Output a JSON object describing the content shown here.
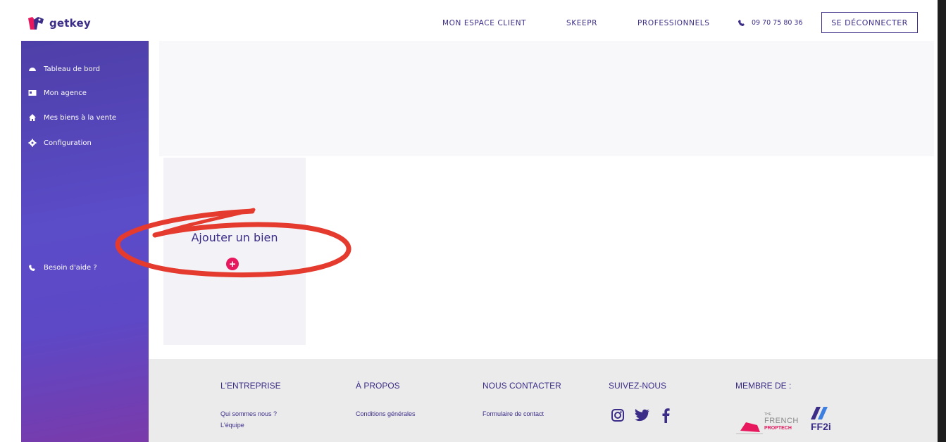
{
  "header": {
    "logo_text": "getkey",
    "nav": [
      "MON ESPACE CLIENT",
      "SKEEPR",
      "PROFESSIONNELS"
    ],
    "phone": "09 70 75 80 36",
    "logout_label": "SE DÉCONNECTER"
  },
  "sidebar": {
    "items": [
      {
        "label": "Tableau de bord",
        "icon": "dashboard-icon"
      },
      {
        "label": "Mon agence",
        "icon": "id-card-icon"
      },
      {
        "label": "Mes biens à la vente",
        "icon": "home-icon"
      },
      {
        "label": "Configuration",
        "icon": "gear-icon"
      }
    ],
    "help_label": "Besoin d'aide ?"
  },
  "main": {
    "add_card_label": "Ajouter un bien"
  },
  "footer": {
    "columns": [
      {
        "heading": "L'ENTREPRISE",
        "links": [
          "Qui sommes nous ?",
          "L'équipe"
        ]
      },
      {
        "heading": "À PROPOS",
        "links": [
          "Conditions générales"
        ]
      },
      {
        "heading": "NOUS CONTACTER",
        "links": [
          "Formulaire de contact"
        ]
      },
      {
        "heading": "SUIVEZ-NOUS",
        "links": []
      },
      {
        "heading": "MEMBRE DE :",
        "links": []
      }
    ],
    "partners": {
      "french_proptech_small": "THE",
      "french_proptech_top": "FRENCH",
      "french_proptech_bottom": "PROPTECH",
      "ff2i": "FF2i"
    }
  },
  "colors": {
    "brand": "#3b2d88",
    "accent": "#e8185f",
    "annotation": "#e53a2e"
  }
}
